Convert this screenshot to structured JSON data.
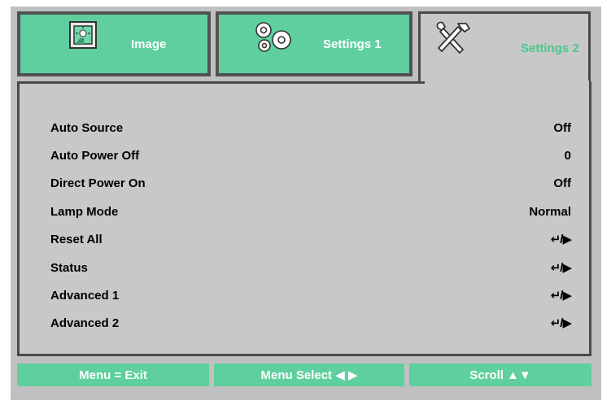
{
  "tabs": [
    {
      "label": "Image",
      "icon": "image-icon",
      "active": false
    },
    {
      "label": "Settings 1",
      "icon": "gears-icon",
      "active": false
    },
    {
      "label": "Settings 2",
      "icon": "tools-icon",
      "active": true
    }
  ],
  "settings": [
    {
      "label": "Auto Source",
      "value": "Off"
    },
    {
      "label": "Auto Power Off",
      "value": "0"
    },
    {
      "label": "Direct Power On",
      "value": "Off"
    },
    {
      "label": "Lamp Mode",
      "value": "Normal"
    },
    {
      "label": "Reset All",
      "value": "↵/▶"
    },
    {
      "label": "Status",
      "value": "↵/▶"
    },
    {
      "label": "Advanced 1",
      "value": "↵/▶"
    },
    {
      "label": "Advanced 2",
      "value": "↵/▶"
    }
  ],
  "footer": {
    "menu_exit": "Menu = Exit",
    "menu_select": "Menu Select ◀ ▶",
    "scroll": "Scroll ▲▼"
  },
  "colors": {
    "tab_green": "#5fcf9f",
    "active_text": "#46c98d",
    "panel_gray": "#c8c8c8",
    "border_dark": "#4a4a4a"
  }
}
